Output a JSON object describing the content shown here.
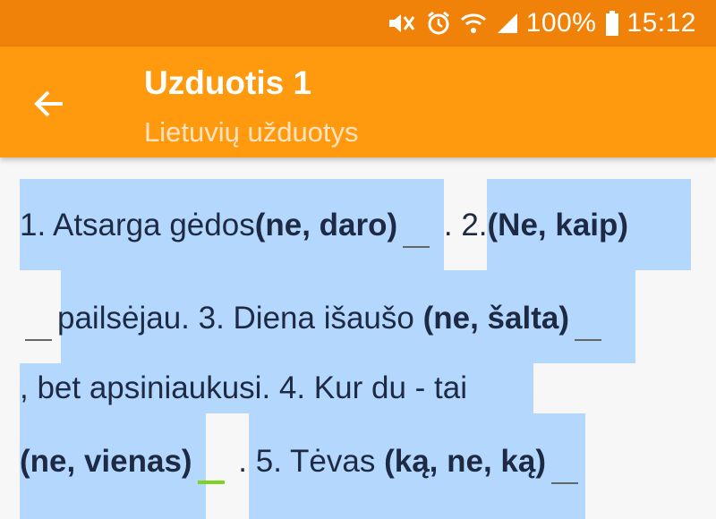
{
  "status_bar": {
    "battery": "100%",
    "time": "15:12"
  },
  "app_bar": {
    "title": "Uzduotis 1",
    "subtitle": "Lietuvių užduotys"
  },
  "exercise": {
    "line1": {
      "t1": "1. Atsarga gėdos",
      "b1": "(ne, daro)",
      "t2": " . 2.",
      "b2": "(Ne, kaip)"
    },
    "line2": {
      "t1": "pailsėjau. 3. Diena išaušo ",
      "b1": "(ne, šalta)"
    },
    "line3": {
      "t1": ", bet apsiniaukusi. 4. Kur du - tai"
    },
    "line4": {
      "b1": "(ne, vienas)",
      "t1": " . 5. Tėvas ",
      "b2": "(ką, ne, ką)"
    }
  },
  "colors": {
    "status": "#f0820a",
    "app_bar": "#ff9a0e",
    "highlight": "#b3d7fd",
    "active_blank": "#7ed321"
  }
}
